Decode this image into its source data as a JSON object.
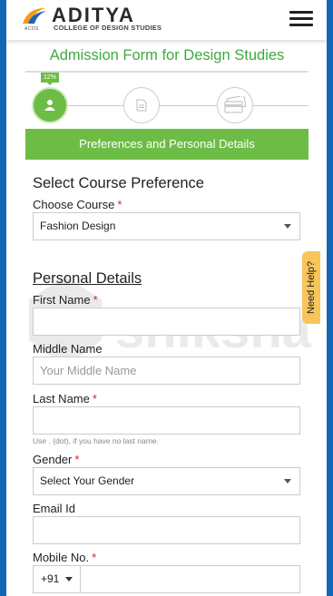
{
  "header": {
    "logo_name": "ADITYA",
    "logo_sub": "COLLEGE OF DESIGN STUDIES",
    "logo_mark_text": "ACDS"
  },
  "form": {
    "title": "Admission Form for Design Studies",
    "progress_badge": "12%",
    "section_banner": "Preferences and Personal Details"
  },
  "course": {
    "heading": "Select Course Preference",
    "choose_label": "Choose Course",
    "required_mark": "*",
    "selected": "Fashion Design"
  },
  "personal": {
    "heading": "Personal Details",
    "first_name_label": "First Name",
    "middle_name_label": "Middle Name",
    "middle_name_placeholder": "Your Middle Name",
    "last_name_label": "Last Name",
    "last_name_hint": "Use . (dot), if you have no last name.",
    "gender_label": "Gender",
    "gender_selected": "Select Your Gender",
    "email_label": "Email Id",
    "mobile_label": "Mobile No.",
    "country_code": "+91"
  },
  "help": {
    "label": "Need Help?"
  },
  "watermark": {
    "text": "shiksha"
  },
  "colors": {
    "frame_blue": "#1565b7",
    "brand_green": "#6dbc45",
    "title_green": "#3eaa3c",
    "help_yellow": "#f7c55a",
    "required_red": "#e02020"
  },
  "icons": {
    "step1": "user-icon",
    "step2": "document-icon",
    "step3": "credit-card-icon",
    "menu": "hamburger-icon"
  }
}
